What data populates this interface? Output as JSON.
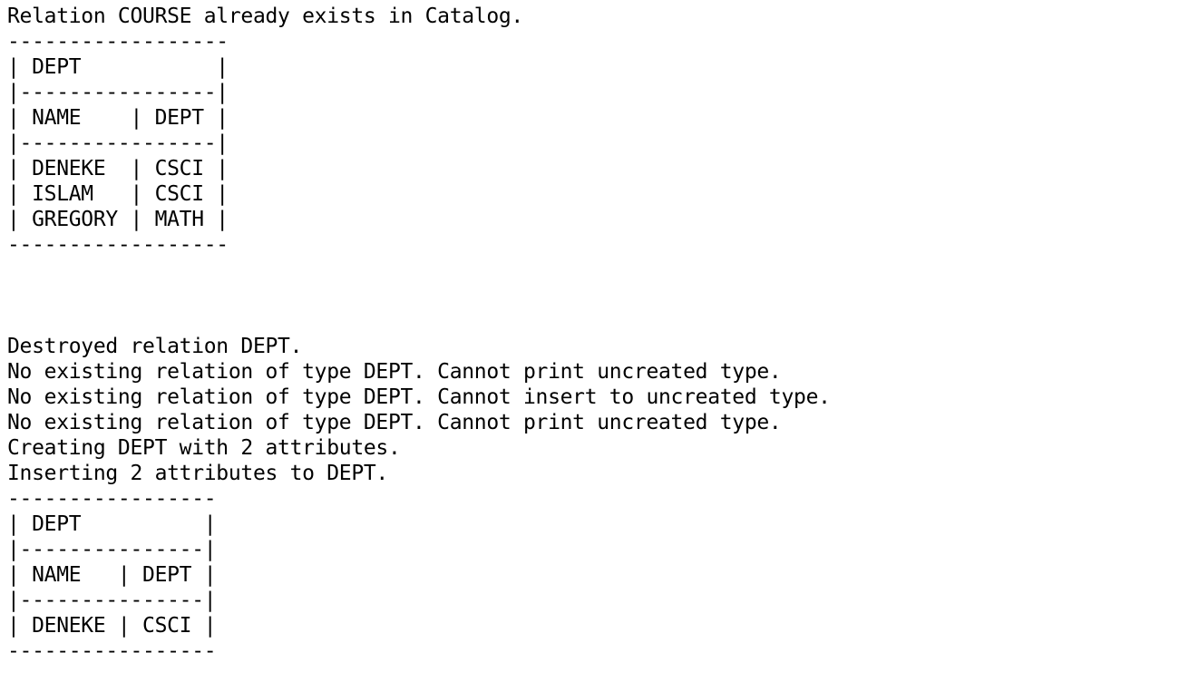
{
  "terminal": {
    "lines": [
      "Relation COURSE already exists in Catalog.",
      "------------------",
      "| DEPT           |",
      "|----------------|",
      "| NAME    | DEPT |",
      "|----------------|",
      "| DENEKE  | CSCI |",
      "| ISLAM   | CSCI |",
      "| GREGORY | MATH |",
      "------------------",
      "",
      "",
      "",
      "Destroyed relation DEPT.",
      "No existing relation of type DEPT. Cannot print uncreated type.",
      "No existing relation of type DEPT. Cannot insert to uncreated type.",
      "No existing relation of type DEPT. Cannot print uncreated type.",
      "Creating DEPT with 2 attributes.",
      "Inserting 2 attributes to DEPT.",
      "-----------------",
      "| DEPT          |",
      "|---------------|",
      "| NAME   | DEPT |",
      "|---------------|",
      "| DENEKE | CSCI |",
      "-----------------"
    ]
  }
}
